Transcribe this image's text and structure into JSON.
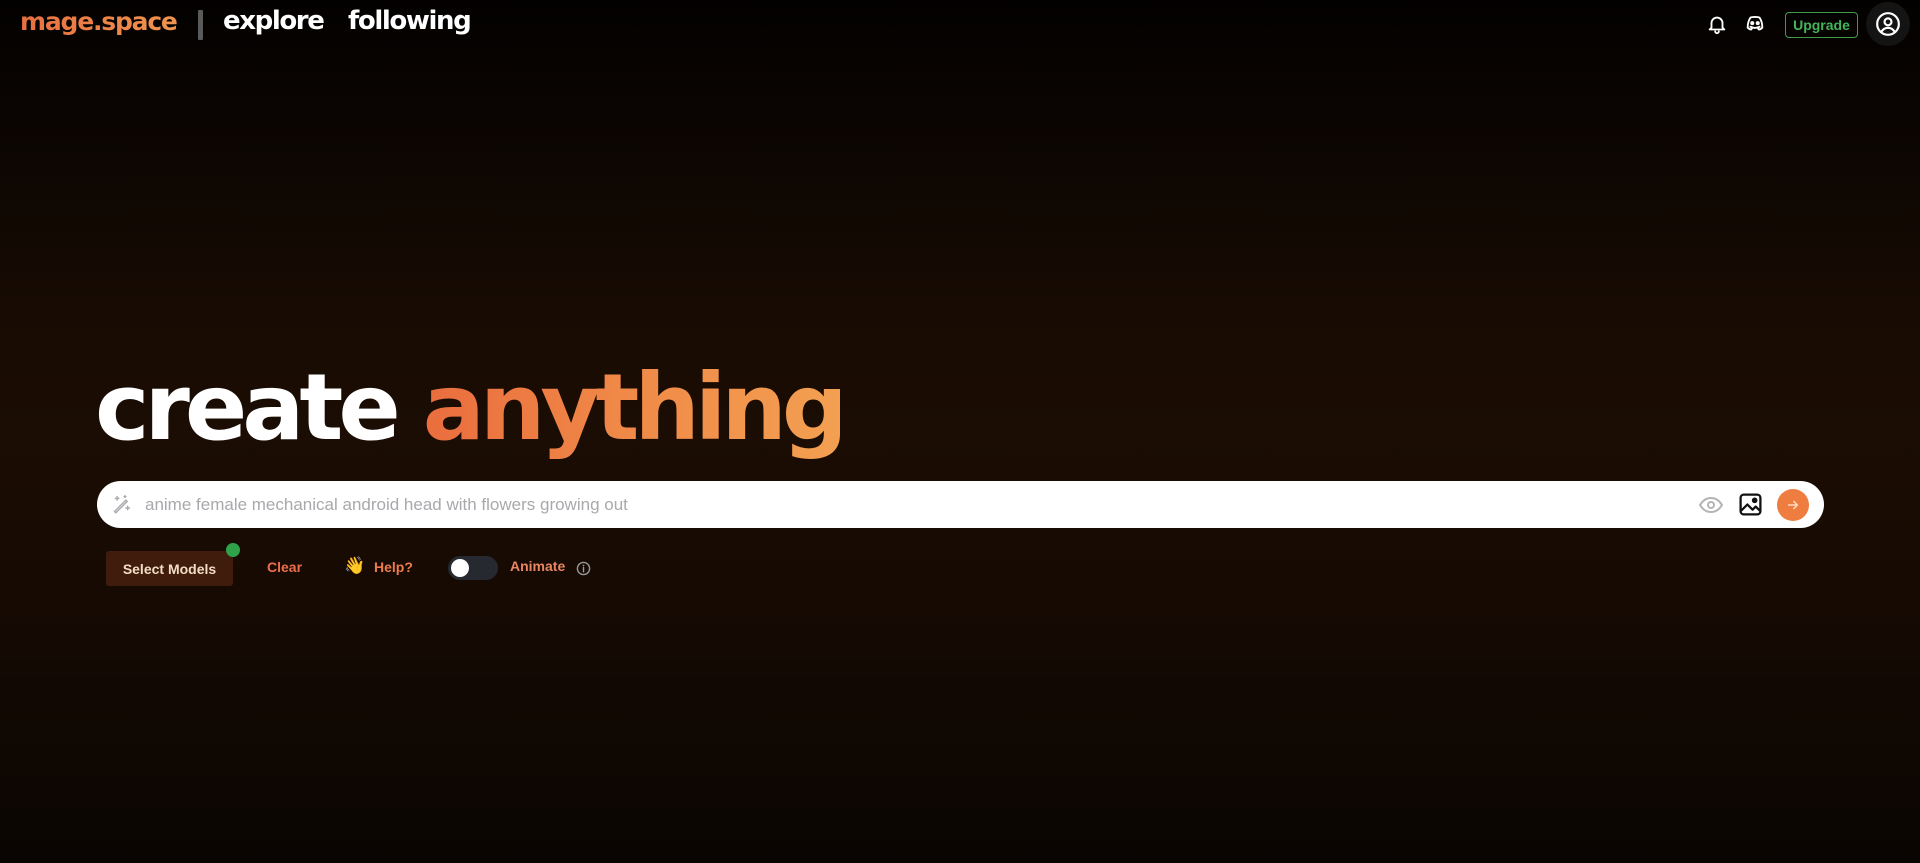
{
  "header": {
    "brand": "mage.space",
    "nav": [
      {
        "label": "explore"
      },
      {
        "label": "following"
      }
    ],
    "icons": [
      "bell-icon",
      "discord-icon",
      "user-circle-icon"
    ],
    "upgrade_label": "Upgrade"
  },
  "hero": {
    "title_white": "create",
    "title_accent": "anything"
  },
  "prompt": {
    "value": "",
    "placeholder": "anime female mechanical android head with flowers growing out",
    "icons": [
      "magic-wand-icon",
      "eye-icon",
      "image-icon",
      "arrow-right-icon"
    ]
  },
  "controls": {
    "select_models_label": "Select Models",
    "clear_label": "Clear",
    "help_emoji": "👋",
    "help_label": "Help?",
    "animate_enabled": false,
    "animate_label": "Animate"
  },
  "colors": {
    "accent": "#ef7d3f",
    "upgrade_green": "#45b35a",
    "status_dot": "#2fa24a",
    "select_models_bg": "#3f1c0b"
  }
}
